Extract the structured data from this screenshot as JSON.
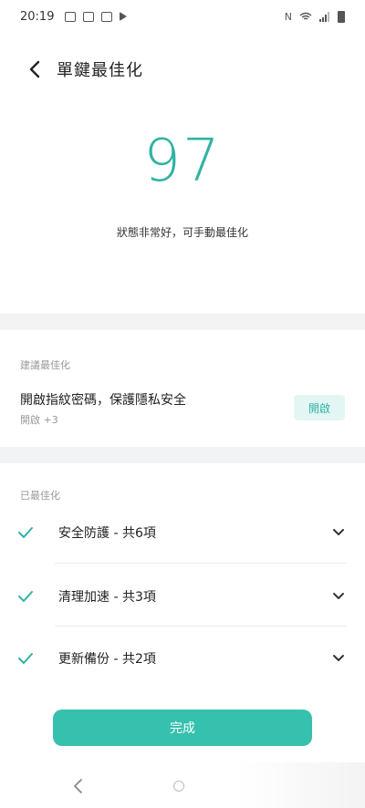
{
  "status_bar": {
    "time": "20:19",
    "network_label": "N"
  },
  "header": {
    "title": "單鍵最佳化"
  },
  "score": {
    "value": "97",
    "description": "狀態非常好，可手動最佳化"
  },
  "suggest_section": {
    "label": "建議最佳化",
    "item_title": "開啟指紋密碼，保護隱私安全",
    "item_sub": "開啟 +3",
    "button_label": "開啟"
  },
  "optimized_section": {
    "label": "已最佳化",
    "items": [
      {
        "label": "安全防護 - 共6項"
      },
      {
        "label": "清理加速 - 共3項"
      },
      {
        "label": "更新備份 - 共2項"
      }
    ]
  },
  "done_button": {
    "label": "完成"
  },
  "colors": {
    "accent": "#2fb3a3",
    "button": "#36c0ae",
    "chip_bg": "#e3f6f3"
  }
}
